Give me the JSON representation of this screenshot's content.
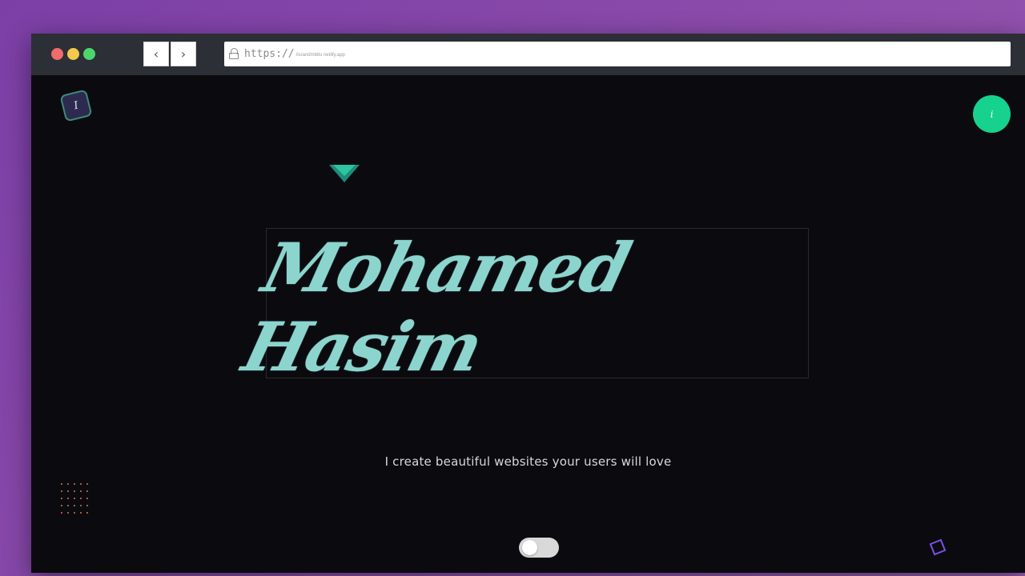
{
  "browser": {
    "url_scheme": "https://",
    "url_host": "/israndmbitu netlify.app",
    "back_label": "‹",
    "forward_label": "›"
  },
  "page": {
    "logo_letter": "I",
    "info_label": "i",
    "name": "Mohamed Hasim",
    "tagline": "I create beautiful websites your users will love"
  },
  "colors": {
    "accent": "#8cd5cf",
    "info_button": "#16d28e",
    "triangle": "#2fc39f",
    "square_outline": "#7b4ee8",
    "dots": "#e0705a",
    "background": "#0b0b0f"
  },
  "icons": {
    "lock": "lock-icon",
    "back": "chevron-left-icon",
    "forward": "chevron-right-icon"
  },
  "theme_toggle": {
    "state": "off"
  }
}
